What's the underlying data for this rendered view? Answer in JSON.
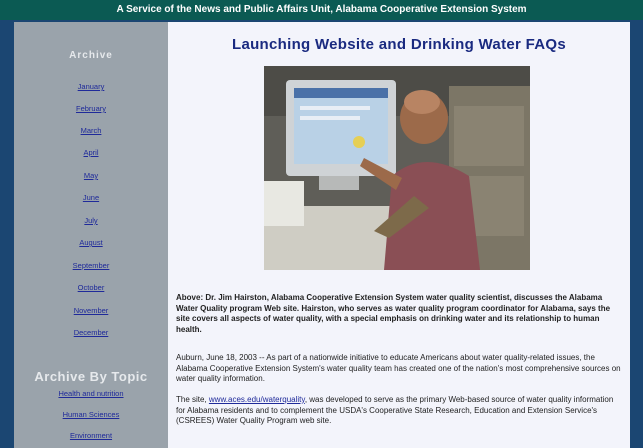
{
  "banner": {
    "text": "A Service of the News and Public Affairs Unit, Alabama Cooperative Extension System"
  },
  "sidebar": {
    "months_heading": "Archive",
    "months": [
      "January",
      "February",
      "March",
      "April",
      "May",
      "June",
      "July",
      "August",
      "September",
      "October",
      "November",
      "December"
    ],
    "topic_heading": "Archive By Topic",
    "topics": [
      "Health and nutrition",
      "Human Sciences",
      "Environment"
    ]
  },
  "article": {
    "title": "Launching Website and Drinking Water FAQs",
    "caption": "Above: Dr. Jim Hairston, Alabama Cooperative Extension System water quality scientist, discusses the Alabama Water Quality program Web site. Hairston, who serves as water quality program coordinator for Alabama, says the site covers all aspects of water quality, with a special emphasis on drinking water and its relationship to human health.",
    "intro": "Auburn, June 18, 2003 -- As part of a nationwide initiative to educate Americans about water quality-related issues, the Alabama Cooperative Extension System's water quality team has created one of the nation's most comprehensive sources on water quality information.",
    "site_prefix": "The site, ",
    "site_link": "www.aces.edu/waterquality",
    "site_suffix": ", was developed to serve as the primary Web-based source of water quality information for Alabama residents and to complement the USDA's Cooperative State Research, Education and Extension Service's (CSREES) Water Quality Program web site."
  }
}
